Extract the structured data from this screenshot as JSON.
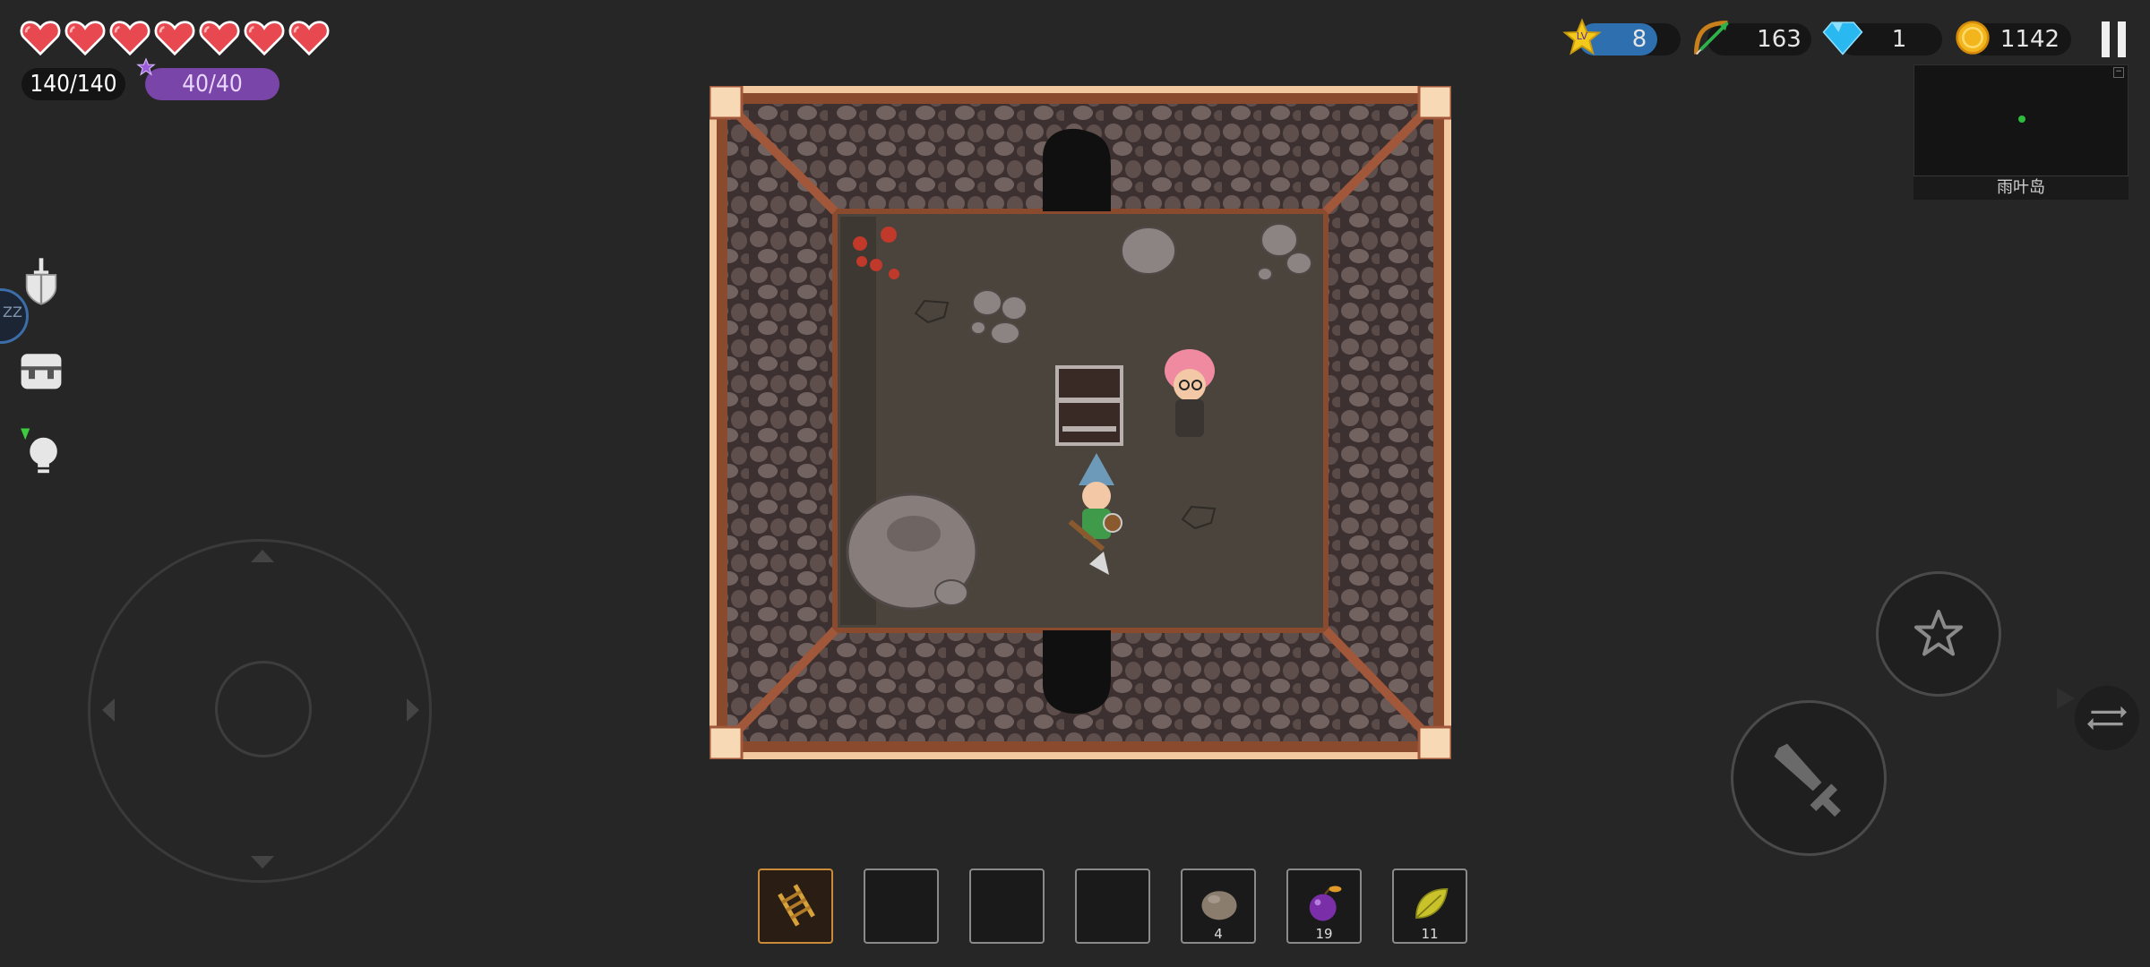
{
  "hud": {
    "hearts": 7,
    "hp_text": "140/140",
    "mp_text": "40/40",
    "level_badge": "LV",
    "level": "8",
    "arrows": "163",
    "gems": "1",
    "coins": "1142"
  },
  "minimap": {
    "location_name": "雨叶岛"
  },
  "side": {
    "sleep_badge": "ZZ"
  },
  "inventory": {
    "slots": [
      {
        "item": "ladder",
        "count": "",
        "selected": true
      },
      {
        "item": "empty",
        "count": ""
      },
      {
        "item": "empty",
        "count": ""
      },
      {
        "item": "empty",
        "count": ""
      },
      {
        "item": "stone",
        "count": "4"
      },
      {
        "item": "plum",
        "count": "19"
      },
      {
        "item": "leaf",
        "count": "11"
      }
    ]
  },
  "colors": {
    "background": "#262626",
    "heart": "#e8484f",
    "mp_bar": "#7a45a8",
    "level_bar": "#2e6fb0",
    "selected_slot": "#c98a3a"
  }
}
